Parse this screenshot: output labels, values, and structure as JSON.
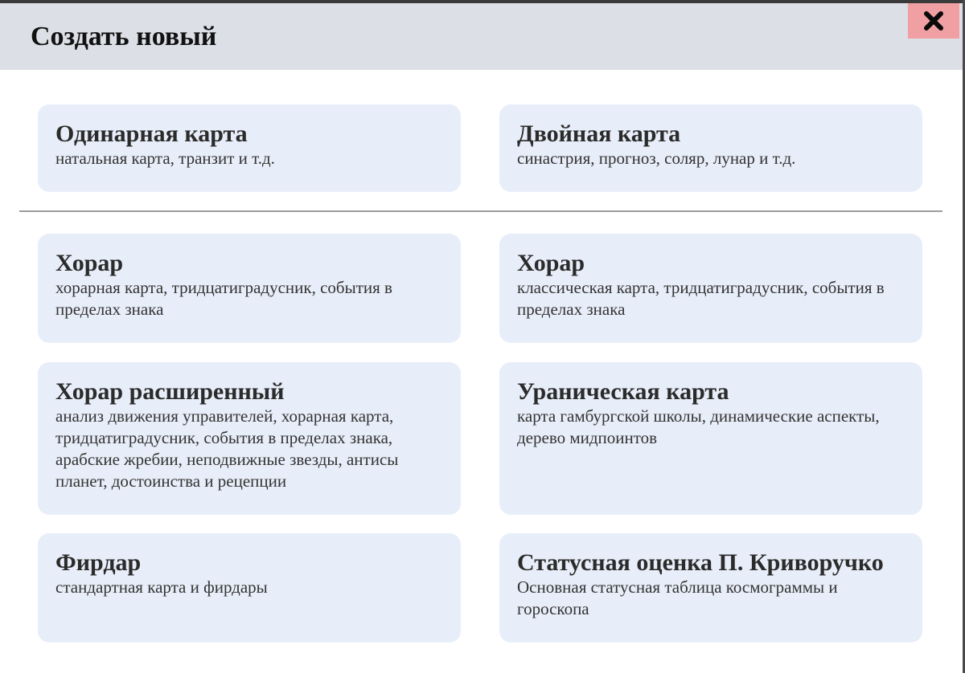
{
  "dialog": {
    "title": "Создать новый",
    "close_icon": "close-icon"
  },
  "colors": {
    "header_bg": "#dcdfe6",
    "card_bg": "#e8eef9",
    "close_bg": "#f0a0a2"
  },
  "cards": [
    {
      "title": "Одинарная карта",
      "description": "натальная карта, транзит и т.д."
    },
    {
      "title": "Двойная карта",
      "description": "синастрия, прогноз, соляр, лунар и т.д."
    },
    {
      "title": "Хорар",
      "description": "хорарная карта, тридцатиградусник, события в пределах знака"
    },
    {
      "title": "Хорар",
      "description": "классическая карта, тридцатиградусник, события в пределах знака"
    },
    {
      "title": "Хорар расширенный",
      "description": "анализ движения управителей, хорарная карта, тридцатиградусник, события в пределах знака, арабские жребии, неподвижные звезды, антисы планет, достоинства и рецепции"
    },
    {
      "title": "Ураническая карта",
      "description": "карта гамбургской школы, динамические аспекты, дерево мидпоинтов"
    },
    {
      "title": "Фирдар",
      "description": "стандартная карта и фирдары"
    },
    {
      "title": "Статусная оценка П. Криворучко",
      "description": "Основная статусная таблица космограммы и гороскопа"
    }
  ]
}
